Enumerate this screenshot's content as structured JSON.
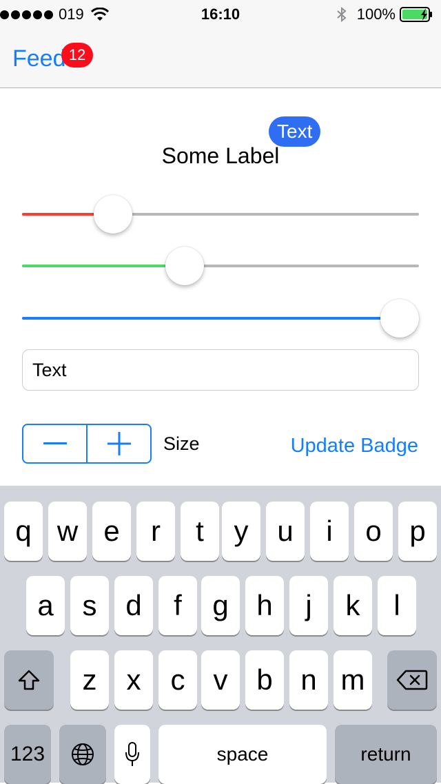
{
  "status_bar": {
    "carrier": "019",
    "time": "16:10",
    "battery_percent": "100%"
  },
  "nav": {
    "back_label": "Feed",
    "badge_count": "12"
  },
  "content": {
    "label": "Some Label",
    "label_badge": "Text",
    "sliders": [
      {
        "color": "#ff3b30",
        "value": 0.2
      },
      {
        "color": "#4cd964",
        "value": 0.4
      },
      {
        "color": "#157efb",
        "value": 1.0
      }
    ],
    "text_field_value": "Text",
    "size_label": "Size",
    "update_badge_label": "Update Badge"
  },
  "keyboard": {
    "row1": [
      "q",
      "w",
      "e",
      "r",
      "t",
      "y",
      "u",
      "i",
      "o",
      "p"
    ],
    "row2": [
      "a",
      "s",
      "d",
      "f",
      "g",
      "h",
      "j",
      "k",
      "l"
    ],
    "row3": [
      "z",
      "x",
      "c",
      "v",
      "b",
      "n",
      "m"
    ],
    "numbers_label": "123",
    "space_label": "space",
    "return_label": "return"
  },
  "colors": {
    "accent": "#157efb",
    "badge_red": "#fc0d1b",
    "label_badge_blue": "#2f6ef3"
  }
}
